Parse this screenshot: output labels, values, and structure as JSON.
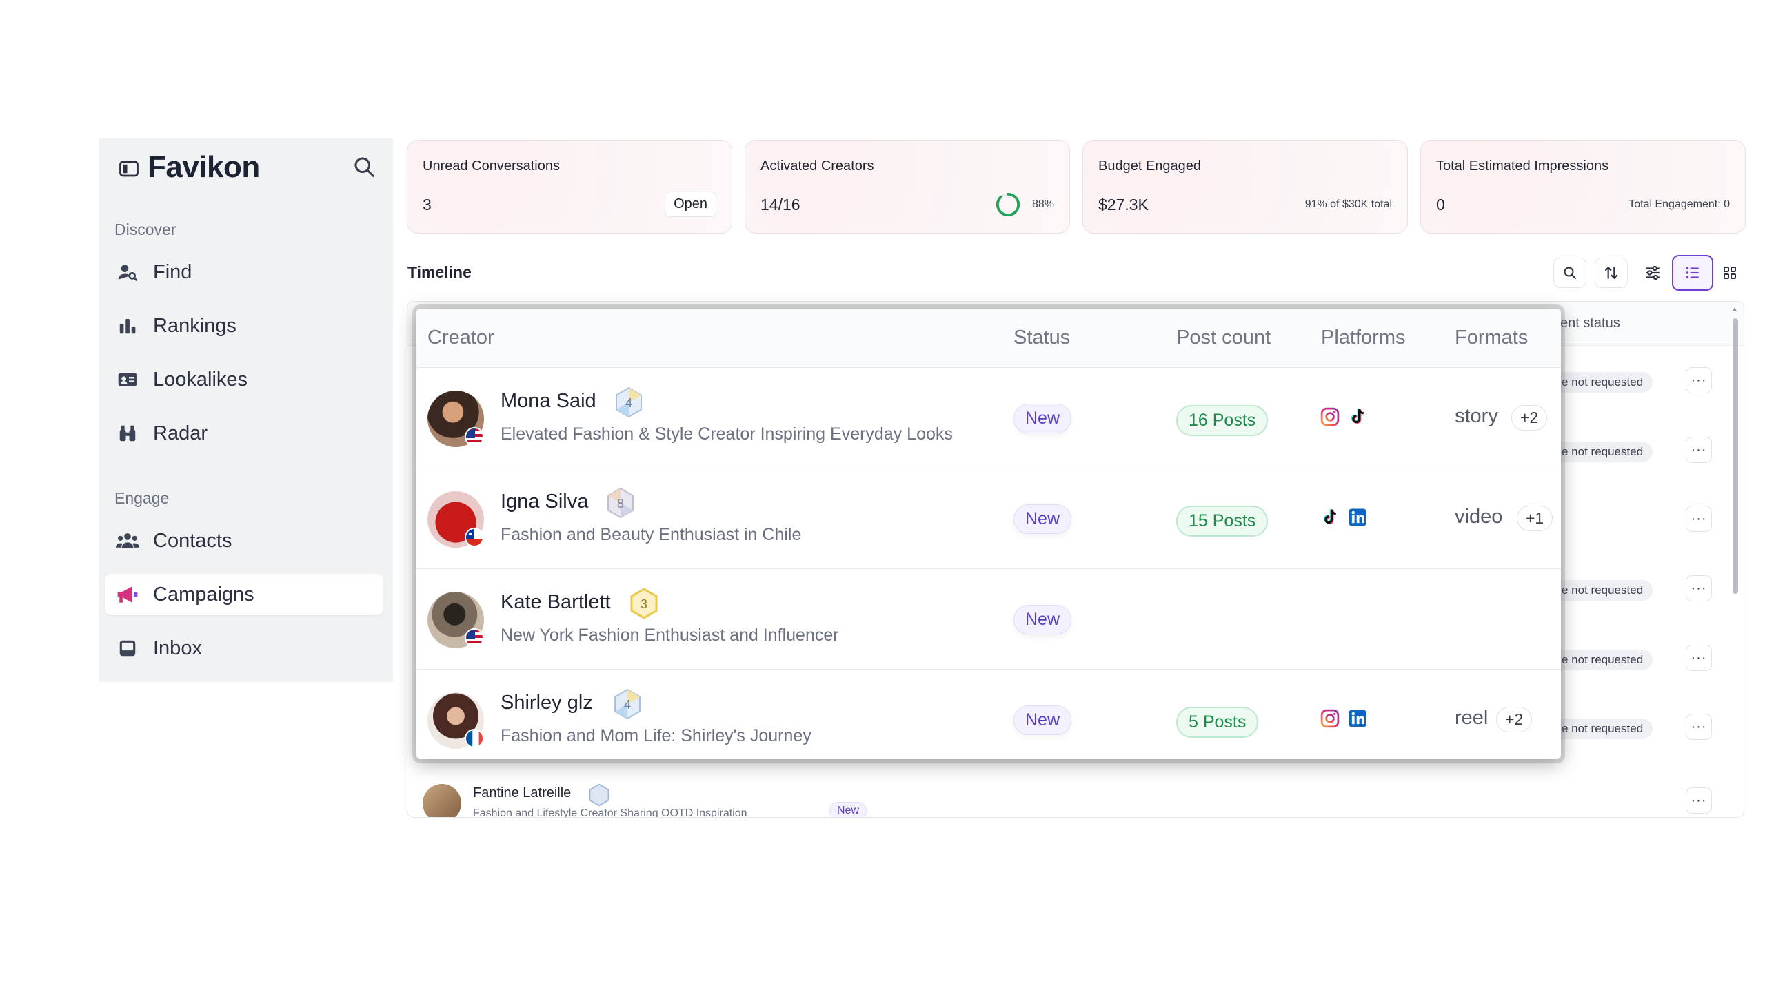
{
  "app": {
    "logo_text": "Favikon",
    "accent": "#6d3fd1"
  },
  "sidebar": {
    "sections": [
      {
        "label": "Discover"
      },
      {
        "label": "Engage"
      }
    ],
    "items": [
      {
        "label": "Find",
        "icon": "find-user-icon"
      },
      {
        "label": "Rankings",
        "icon": "bar-chart-icon"
      },
      {
        "label": "Lookalikes",
        "icon": "id-card-icon"
      },
      {
        "label": "Radar",
        "icon": "binoculars-icon"
      },
      {
        "label": "Contacts",
        "icon": "people-icon"
      },
      {
        "label": "Campaigns",
        "icon": "megaphone-icon",
        "active": true
      },
      {
        "label": "Inbox",
        "icon": "inbox-icon"
      }
    ]
  },
  "stats": {
    "unread": {
      "title": "Unread Conversations",
      "value": "3",
      "button": "Open"
    },
    "activated": {
      "title": "Activated Creators",
      "value": "14/16",
      "percent_label": "88%",
      "progress": 0.88
    },
    "budget": {
      "title": "Budget Engaged",
      "value": "$27.3K",
      "note": "91% of $30K total"
    },
    "impressions": {
      "title": "Total Estimated Impressions",
      "value": "0",
      "note": "Total Engagement: 0"
    }
  },
  "timeline": {
    "title": "Timeline"
  },
  "background_table": {
    "status_header": "ent status",
    "pill_text": "e not requested",
    "more_label": "···",
    "fantine": {
      "name": "Fantine Latreille",
      "desc": "Fashion and Lifestyle Creator Sharing OOTD Inspiration",
      "status": "New"
    }
  },
  "zoom_table": {
    "headers": {
      "creator": "Creator",
      "status": "Status",
      "post_count": "Post count",
      "platforms": "Platforms",
      "formats": "Formats"
    },
    "rows": [
      {
        "name": "Mona Said",
        "badge": "4",
        "desc": "Elevated Fashion & Style Creator Inspiring Everyday Looks",
        "status": "New",
        "posts": "16 Posts",
        "platforms": [
          "instagram-icon",
          "tiktok-icon"
        ],
        "format": "story",
        "format_more": "+2",
        "flag": "us-flag-icon"
      },
      {
        "name": "Igna Silva",
        "badge": "8",
        "desc": "Fashion and Beauty Enthusiast in Chile",
        "status": "New",
        "posts": "15 Posts",
        "platforms": [
          "tiktok-icon",
          "linkedin-icon"
        ],
        "format": "video",
        "format_more": "+1",
        "flag": "chile-flag-icon"
      },
      {
        "name": "Kate Bartlett",
        "badge": "3",
        "desc": "New York Fashion Enthusiast and Influencer",
        "status": "New",
        "flag": "us-flag-icon"
      },
      {
        "name": "Shirley glz",
        "badge": "4",
        "desc": "Fashion and Mom Life: Shirley's Journey",
        "status": "New",
        "posts": "5 Posts",
        "platforms": [
          "instagram-icon",
          "linkedin-icon"
        ],
        "format": "reel",
        "format_more": "+2",
        "flag": "france-flag-icon"
      }
    ]
  }
}
